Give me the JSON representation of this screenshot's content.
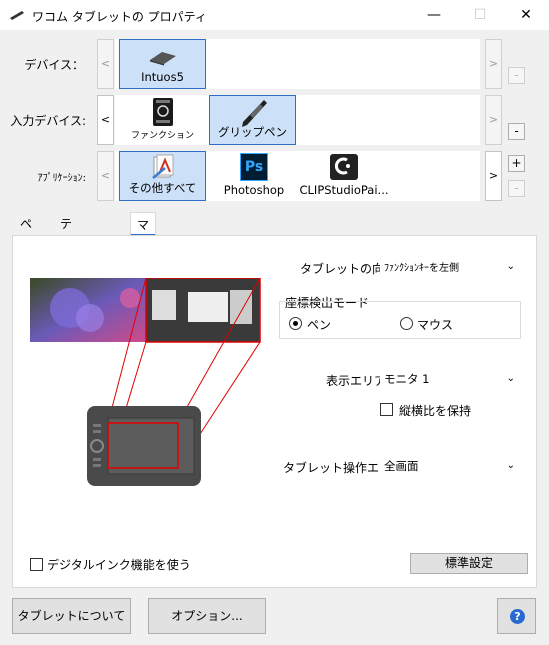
{
  "window": {
    "title": "ワコム タブレットの プロパティ",
    "minimize": "—",
    "maximize": "☐",
    "close": "✕"
  },
  "rows": {
    "device": {
      "label": "デバイス：",
      "prev": "<",
      "next": ">",
      "items": [
        {
          "label": "Intuos5",
          "icon": "tablet-icon",
          "selected": true
        }
      ],
      "side_buttons": [
        "-"
      ]
    },
    "input": {
      "label": "入力デバイス:",
      "prev": "<",
      "next": ">",
      "items": [
        {
          "label": "ファンクション",
          "icon": "function-keys-icon",
          "selected": false
        },
        {
          "label": "グリップペン",
          "icon": "pen-icon",
          "selected": true
        }
      ],
      "side_buttons": [
        "-"
      ]
    },
    "app": {
      "label": "ｱﾌﾟﾘｹｰｼｮﾝ:",
      "prev": "<",
      "next": ">",
      "items": [
        {
          "label": "その他すべて",
          "icon": "all-apps-icon",
          "selected": true
        },
        {
          "label": "Photoshop",
          "icon": "photoshop-icon",
          "selected": false,
          "icon_text": "Ps"
        },
        {
          "label": "CLIPStudioPai...",
          "icon": "clip-studio-icon",
          "selected": false
        }
      ],
      "side_buttons": [
        "+",
        "-"
      ]
    }
  },
  "tabs": [
    "ペン",
    "テールスイッチ",
    "マッピング"
  ],
  "active_tab": "マッピング",
  "mapping": {
    "orientation": {
      "label": "タブレットの向き:",
      "value": "ﾌｧﾝｸｼｮﾝｷｰを左側"
    },
    "mode": {
      "legend": "座標検出モード",
      "options": [
        {
          "label": "ペン",
          "checked": true
        },
        {
          "label": "マウス",
          "checked": false
        }
      ]
    },
    "display_area": {
      "label": "表示エリア:",
      "value": "モニタ 1"
    },
    "keep_aspect": {
      "label": "縦横比を保持",
      "checked": false
    },
    "tablet_area": {
      "label": "タブレット操作エリア:",
      "value": "全画面"
    },
    "digital_ink": {
      "label": "デジタルインク機能を使う",
      "checked": false
    },
    "default_button": "標準設定"
  },
  "footer": {
    "about": "タブレットについて",
    "options": "オプション...",
    "help": "?"
  },
  "colors": {
    "accent": "#2f6ec6",
    "selected_fill": "#cce0f7",
    "mapping_line": "#e00000"
  }
}
